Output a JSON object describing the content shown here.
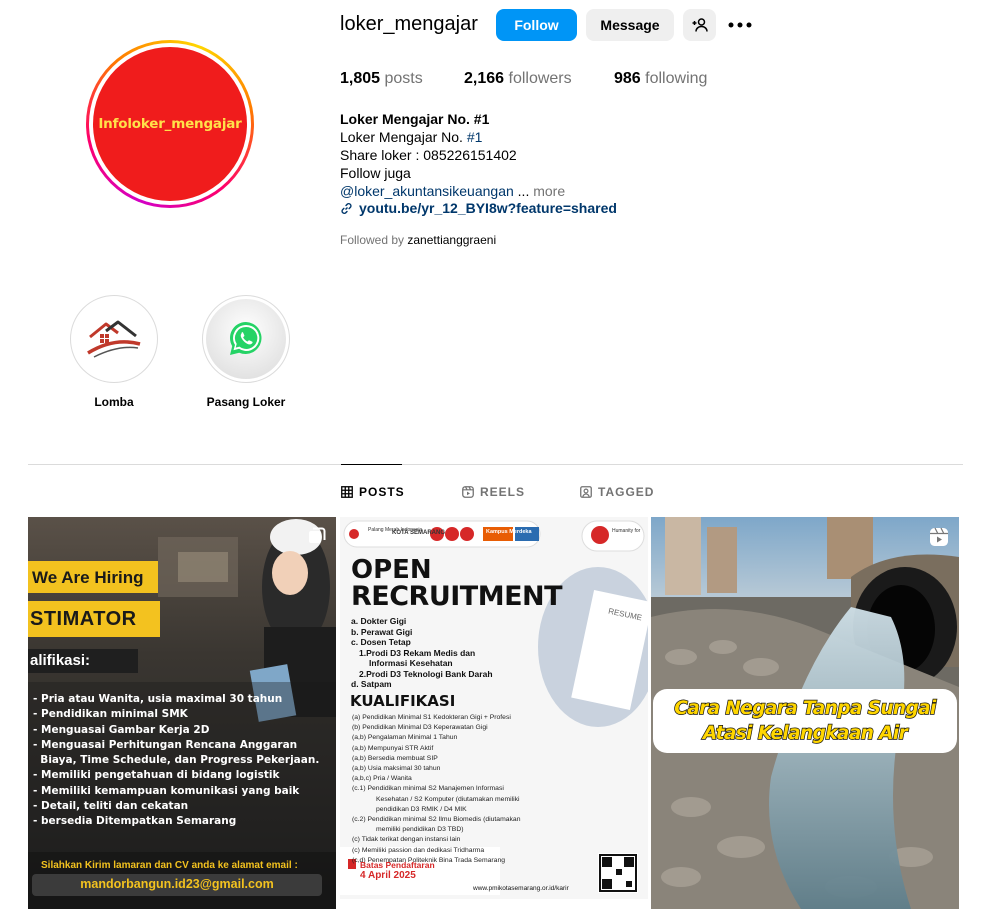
{
  "profile": {
    "username": "loker_mengajar",
    "avatar_text": "Infoloker_mengajar",
    "follow_label": "Follow",
    "message_label": "Message",
    "stats": {
      "posts_count": "1,805",
      "posts_label": "posts",
      "followers_count": "2,166",
      "followers_label": "followers",
      "following_count": "986",
      "following_label": "following"
    },
    "bio": {
      "name": "Loker Mengajar No. #1",
      "line1_text": "Loker Mengajar No.",
      "line1_hashtag": "#1",
      "line2": "Share loker : 085226151402",
      "line3": "Follow juga",
      "mention": "@loker_akuntansikeuangan",
      "ellipsis": " ...",
      "more": "more",
      "link": "youtu.be/yr_12_BYI8w?feature=shared"
    },
    "followed_by_label": "Followed by",
    "followed_by_user": "zanettianggraeni"
  },
  "highlights": [
    {
      "label": "Lomba",
      "icon": "house-logo-icon"
    },
    {
      "label": "Pasang Loker",
      "icon": "whatsapp-icon"
    }
  ],
  "tabs": [
    {
      "label": "POSTS",
      "icon": "grid-icon",
      "active": true
    },
    {
      "label": "REELS",
      "icon": "reels-icon",
      "active": false
    },
    {
      "label": "TAGGED",
      "icon": "tagged-icon",
      "active": false
    }
  ],
  "posts": [
    {
      "type": "carousel",
      "banner": "We Are Hiring",
      "title": "STIMATOR",
      "section": "alifikasi:",
      "items": [
        "- Pria atau Wanita, usia maximal 30 tahun",
        "- Pendidikan minimal SMK",
        "- Menguasai Gambar Kerja 2D",
        "- Menguasai Perhitungan Rencana Anggaran",
        "  Biaya, Time Schedule, dan Progress Pekerjaan.",
        "- Memiliki pengetahuan di bidang logistik",
        "- Memiliki kemampuan komunikasi yang baik",
        "- Detail, teliti dan cekatan",
        "- bersedia Ditempatkan Semarang"
      ],
      "footer_note": "Silahkan Kirim lamaran dan CV anda ke alamat email :",
      "email": "mandorbangun.id23@gmail.com"
    },
    {
      "type": "image",
      "header_tags": [
        "Palang Merah Indonesia",
        "KOTA SEMARANG",
        "Kampus Merdeka",
        "Humanity for"
      ],
      "title1": "OPEN",
      "title2": "RECRUITMENT",
      "positions": [
        "a. Dokter Gigi",
        "b. Perawat Gigi",
        "c. Dosen Tetap",
        "1.Prodi D3 Rekam Medis dan",
        "Informasi Kesehatan",
        "2.Prodi D3 Teknologi Bank Darah",
        "d. Satpam"
      ],
      "resume_label": "RESUME",
      "qual_title": "KUALIFIKASI",
      "quals": [
        "(a) Pendidikan Minimal S1 Kedokteran Gigi + Profesi",
        "(b) Pendidikan Minimal D3 Keperawatan Gigi",
        "(a,b) Pengalaman Minimal 1 Tahun",
        "(a,b) Mempunyai STR Aktif",
        "(a,b) Bersedia membuat SIP",
        "(a,b) Usia maksimal 30 tahun",
        "(a,b,c) Pria / Wanita",
        "(c.1) Pendidikan minimal S2 Manajemen Informasi",
        "Kesehatan / S2 Komputer (diutamakan memiliki",
        "pendidikan D3 RMIK / D4 MIK",
        "(c.2) Pendidikan minimal S2 Ilmu Biomedis (diutamakan",
        "memiliki pendidikan D3 TBD)",
        "(c) Tidak terikat dengan instansi lain",
        "(c) Memiliki passion dan dedikasi Tridharma",
        "(c,d) Penempatan Politeknik Bina Trada Semarang"
      ],
      "deadline_label": "Batas Pendaftaran",
      "deadline_date": "4 April 2025",
      "website": "www.pmikotasemarang.or.id/karir"
    },
    {
      "type": "reel",
      "caption1": "Cara Negara Tanpa Sungai",
      "caption2": "Atasi Kelangkaan Air"
    }
  ],
  "colors": {
    "follow_blue": "#0095f6",
    "link_blue": "#00376b",
    "muted": "#737373",
    "avatar_red": "#f01c1c",
    "avatar_text_yellow": "#ffe14a"
  }
}
